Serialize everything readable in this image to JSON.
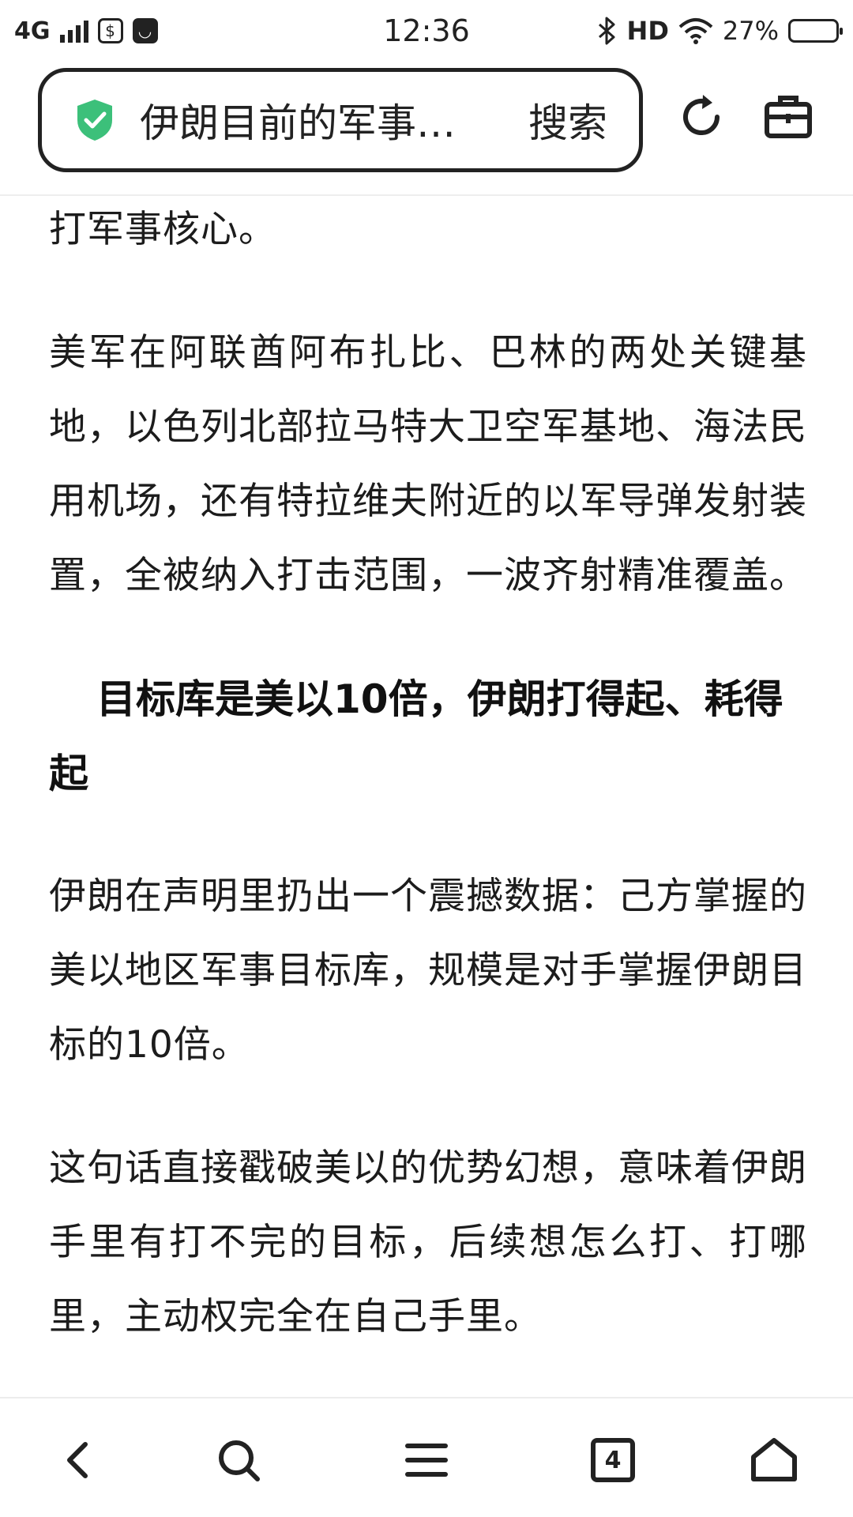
{
  "status_bar": {
    "network": "4G",
    "time": "12:36",
    "hd": "HD",
    "battery_percent": "27%",
    "battery_level": 0.27
  },
  "top_bar": {
    "url_text": "伊朗目前的军事…",
    "search_label": "搜索",
    "secure_icon": "shield-check-icon",
    "reload_icon": "reload-icon",
    "toolbox_icon": "toolbox-icon"
  },
  "article": {
    "p0": "打军事核心。",
    "p1": "美军在阿联酋阿布扎比、巴林的两处关键基地，以色列北部拉马特大卫空军基地、海法民用机场，还有特拉维夫附近的以军导弹发射装置，全被纳入打击范围，一波齐射精准覆盖。",
    "h1": "目标库是美以10倍，伊朗打得起、耗得起",
    "p2": "伊朗在声明里扔出一个震撼数据：己方掌握的美以地区军事目标库，规模是对手掌握伊朗目标的10倍。",
    "p3": "这句话直接戳破美以的优势幻想，意味着伊朗手里有打不完的目标，后续想怎么打、打哪里，主动权完全在自己手里。"
  },
  "bottom_nav": {
    "tab_count": "4",
    "icons": [
      "back-icon",
      "search-icon",
      "menu-icon",
      "tabs-icon",
      "home-icon"
    ]
  }
}
